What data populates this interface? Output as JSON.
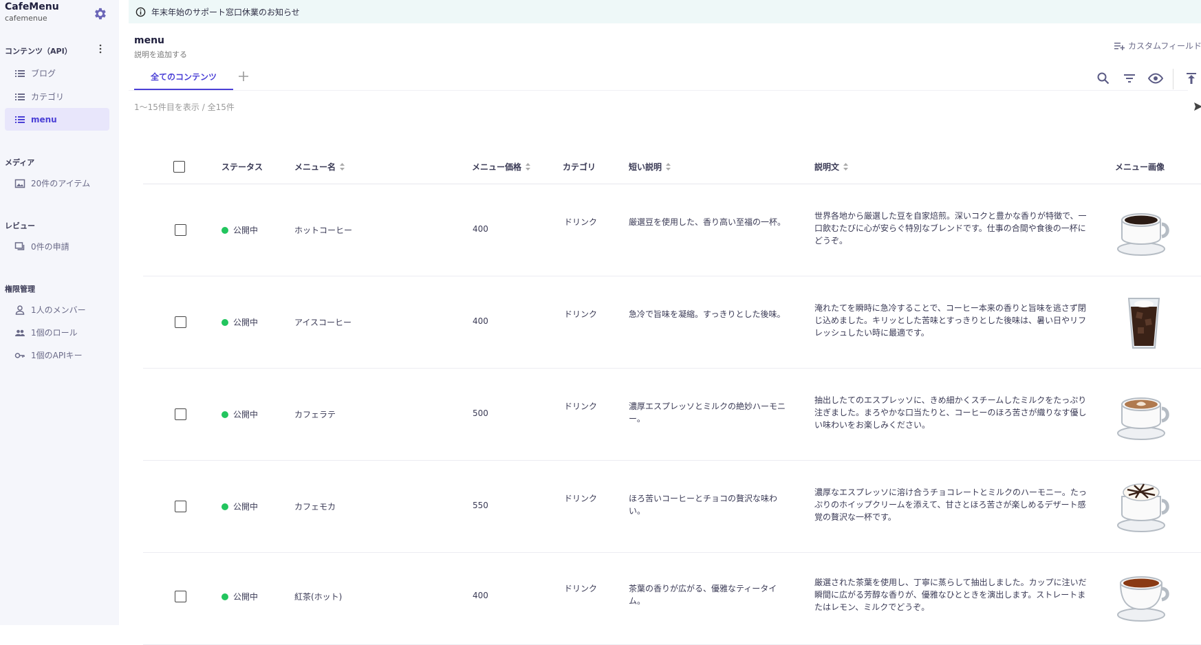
{
  "app": {
    "name": "CafeMenu",
    "id": "cafemenue"
  },
  "sidebar": {
    "contents_header": "コンテンツ（API）",
    "contents": [
      {
        "label": "ブログ"
      },
      {
        "label": "カテゴリ"
      },
      {
        "label": "menu"
      }
    ],
    "media_header": "メディア",
    "media_item": "20件のアイテム",
    "review_header": "レビュー",
    "review_item": "0件の申請",
    "perm_header": "権限管理",
    "perm_items": [
      {
        "label": "1人のメンバー"
      },
      {
        "label": "1個のロール"
      },
      {
        "label": "1個のAPIキー"
      }
    ]
  },
  "banner": {
    "text": "年末年始のサポート窓口休業のお知らせ"
  },
  "page": {
    "title": "menu",
    "description": "説明を追加する",
    "custom_field": "カスタムフィールド",
    "tab_all": "全てのコンテンツ",
    "count": "1〜15件目を表示 / 全15件"
  },
  "table": {
    "headers": {
      "status": "ステータス",
      "name": "メニュー名",
      "price": "メニュー価格",
      "category": "カテゴリ",
      "short": "短い説明",
      "desc": "説明文",
      "image": "メニュー画像"
    },
    "rows": [
      {
        "status": "公開中",
        "name": "ホットコーヒー",
        "price": "400",
        "category": "ドリンク",
        "short": "厳選豆を使用した、香り高い至福の一杯。",
        "desc": "世界各地から厳選した豆を自家焙煎。深いコクと豊かな香りが特徴で、一口飲むたびに心が安らぐ特別なブレンドです。仕事の合間や食後の一杯にどうぞ。",
        "image": "hot-coffee"
      },
      {
        "status": "公開中",
        "name": "アイスコーヒー",
        "price": "400",
        "category": "ドリンク",
        "short": "急冷で旨味を凝縮。すっきりとした後味。",
        "desc": "淹れたてを瞬時に急冷することで、コーヒー本来の香りと旨味を逃さず閉じ込めました。キリッとした苦味とすっきりとした後味は、暑い日やリフレッシュしたい時に最適です。",
        "image": "iced-coffee"
      },
      {
        "status": "公開中",
        "name": "カフェラテ",
        "price": "500",
        "category": "ドリンク",
        "short": "濃厚エスプレッソとミルクの絶妙ハーモニー。",
        "desc": "抽出したてのエスプレッソに、きめ細かくスチームしたミルクをたっぷり注ぎました。まろやかな口当たりと、コーヒーのほろ苦さが織りなす優しい味わいをお楽しみください。",
        "image": "latte"
      },
      {
        "status": "公開中",
        "name": "カフェモカ",
        "price": "550",
        "category": "ドリンク",
        "short": "ほろ苦いコーヒーとチョコの贅沢な味わい。",
        "desc": "濃厚なエスプレッソに溶け合うチョコレートとミルクのハーモニー。たっぷりのホイップクリームを添えて、甘さとほろ苦さが楽しめるデザート感覚の贅沢な一杯です。",
        "image": "mocha"
      },
      {
        "status": "公開中",
        "name": "紅茶(ホット)",
        "price": "400",
        "category": "ドリンク",
        "short": "茶葉の香りが広がる、優雅なティータイム。",
        "desc": "厳選された茶葉を使用し、丁寧に蒸らして抽出しました。カップに注いだ瞬間に広がる芳醇な香りが、優雅なひとときを演出します。ストレートまたはレモン、ミルクでどうぞ。",
        "image": "tea"
      }
    ]
  },
  "colors": {
    "accent": "#4a3fd6",
    "status_green": "#22c55e",
    "banner_bg": "#eef8f8",
    "sidebar_bg": "#f5f6fb"
  }
}
